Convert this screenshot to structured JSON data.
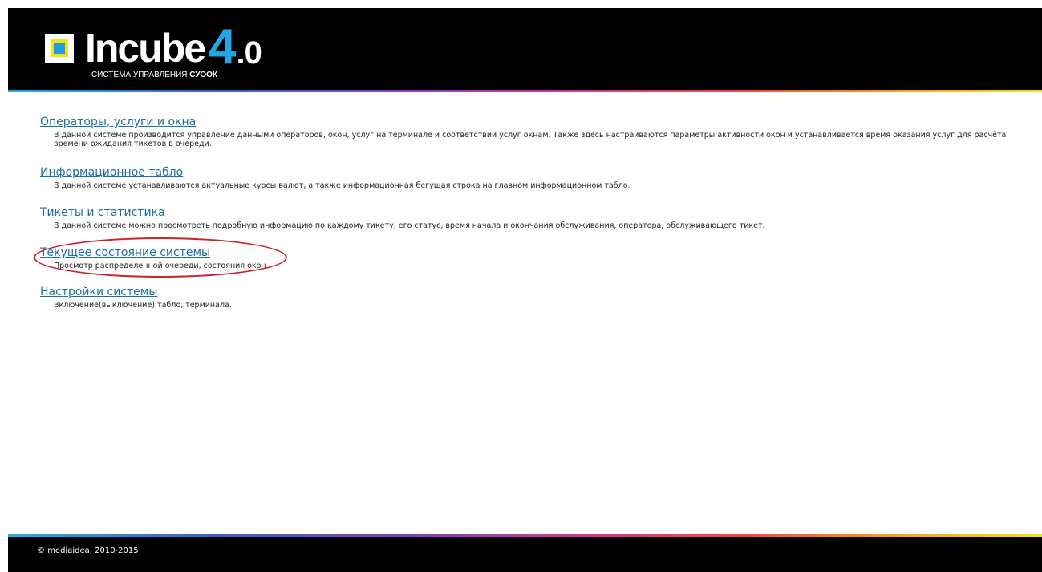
{
  "header": {
    "logo_word": "Incube",
    "logo_version_major": "4",
    "logo_version_minor": ".0",
    "logo_caption_prefix": "СИСТЕМА УПРАВЛЕНИЯ",
    "logo_caption_bold": "СУООК"
  },
  "sections": [
    {
      "title": "Операторы, услуги и окна",
      "description": "В данной системе производится управление данными операторов, окон, услуг на терминале и соответствий услуг окнам. Также здесь настраиваются параметры активности окон и устанавливается время оказания услуг для расчёта времени ожидания тикетов в очереди."
    },
    {
      "title": "Информационное табло",
      "description": "В данной системе устанавливаются актуальные курсы валют, а также информационная бегущая строка на главном информационном табло."
    },
    {
      "title": "Тикеты и статистика",
      "description": "В данной системе можно просмотреть подробную информацию по каждому тикету, его статус, время начала и окончания обслуживания, оператора, обслуживающего тикет."
    },
    {
      "title": "Текущее состояние системы",
      "description": "Просмотр распределенной очереди, состояния окон."
    },
    {
      "title": "Настройки системы",
      "description": "Включение(выключение) табло, терминала."
    }
  ],
  "footer": {
    "copyright_symbol": "©",
    "company_link": "mediaidea",
    "years": ", 2010-2015"
  },
  "colors": {
    "link": "#1c6ea4",
    "header_bg": "#000000",
    "highlight": "#c8242a",
    "logo_accent": "#22a7e4"
  }
}
